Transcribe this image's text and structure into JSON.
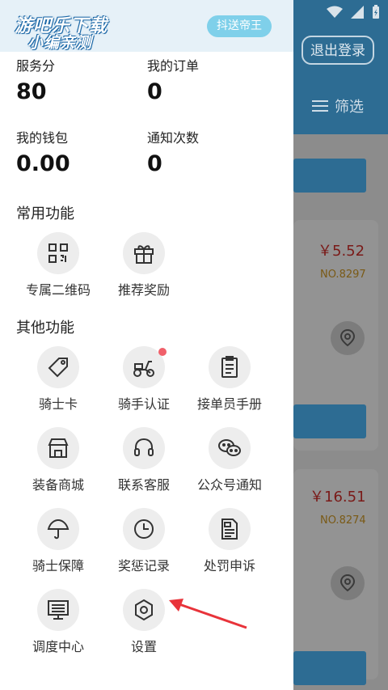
{
  "background": {
    "logout_label": "退出登录",
    "filter_label": "筛选",
    "orders": [
      {
        "price": "￥5.52",
        "number": "NO.8297"
      },
      {
        "price": "￥16.51",
        "number": "NO.8274"
      }
    ]
  },
  "drawer": {
    "watermark": {
      "line1": "游吧乐下载",
      "line2": "小编亲测"
    },
    "tag": "抖送帝王",
    "stats": [
      {
        "label": "服务分",
        "value": "80"
      },
      {
        "label": "我的订单",
        "value": "0"
      },
      {
        "label": "我的钱包",
        "value": "0.00"
      },
      {
        "label": "通知次数",
        "value": "0"
      }
    ],
    "common_title": "常用功能",
    "common_items": [
      {
        "label": "专属二维码",
        "icon": "qr-code-icon"
      },
      {
        "label": "推荐奖励",
        "icon": "gift-icon"
      }
    ],
    "other_title": "其他功能",
    "other_items": [
      {
        "label": "骑士卡",
        "icon": "tag-icon"
      },
      {
        "label": "骑手认证",
        "icon": "scooter-icon"
      },
      {
        "label": "接单员手册",
        "icon": "clipboard-icon"
      },
      {
        "label": "装备商城",
        "icon": "store-icon"
      },
      {
        "label": "联系客服",
        "icon": "headset-icon"
      },
      {
        "label": "公众号通知",
        "icon": "wechat-icon"
      },
      {
        "label": "骑士保障",
        "icon": "umbrella-icon"
      },
      {
        "label": "奖惩记录",
        "icon": "clock-icon"
      },
      {
        "label": "处罚申诉",
        "icon": "document-icon"
      },
      {
        "label": "调度中心",
        "icon": "monitor-icon"
      },
      {
        "label": "设置",
        "icon": "gear-icon"
      }
    ]
  },
  "colors": {
    "header_blue": "#2d6c93",
    "badge_red": "#f0606a",
    "arrow_red": "#e8333a",
    "tag_blue": "#7fd0ea"
  }
}
